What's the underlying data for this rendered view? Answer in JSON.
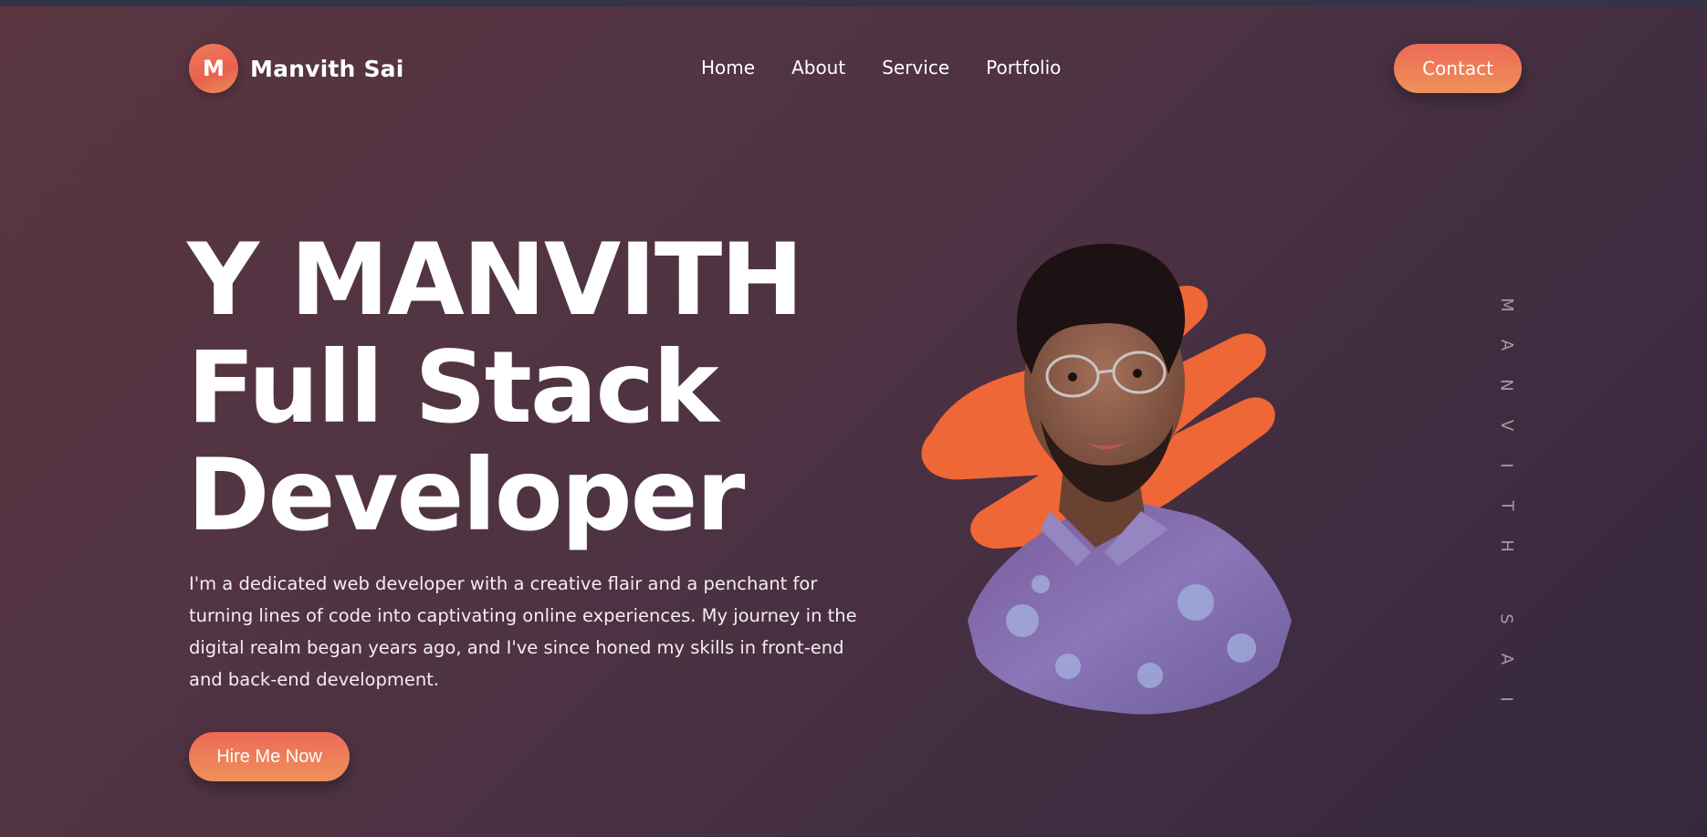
{
  "logo": {
    "initial": "M",
    "name": "Manvith Sai"
  },
  "nav": {
    "items": [
      {
        "label": "Home"
      },
      {
        "label": "About"
      },
      {
        "label": "Service"
      },
      {
        "label": "Portfolio"
      }
    ],
    "contact_label": "Contact"
  },
  "hero": {
    "lines": [
      "Y MANVITH",
      "Full Stack",
      "Developer"
    ],
    "description": "I'm a dedicated web developer with a creative flair and a penchant for turning lines of code into captivating online experiences. My journey in the digital realm began years ago, and I've since honed my skills in front-end and back-end development.",
    "cta_label": "Hire Me Now"
  },
  "vertical_name": [
    "M",
    "A",
    "N",
    "V",
    "I",
    "T",
    "H",
    " ",
    "S",
    "A",
    "I"
  ],
  "colors": {
    "accent_start": "#ec6a58",
    "accent_end": "#ef9158",
    "splash": "#ef6637",
    "bg_start": "#5a3540",
    "bg_end": "#35283d"
  },
  "icons": {
    "portrait": "profile-photo"
  }
}
